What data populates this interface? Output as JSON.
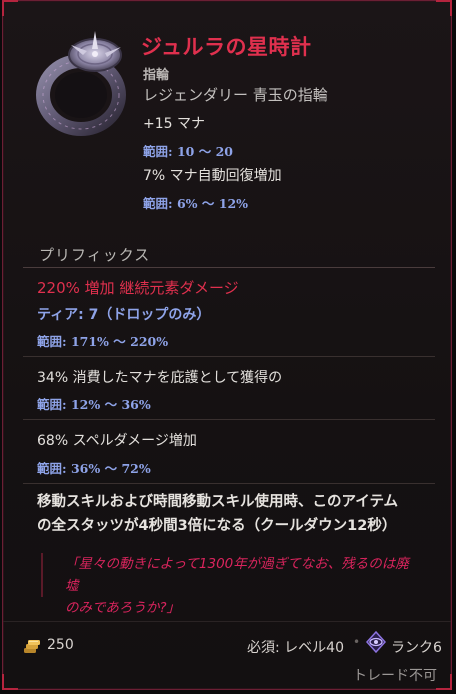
{
  "item": {
    "name": "ジュルラの星時計",
    "type": "指輪",
    "rarity_line": "レジェンダリー 青玉の指輪"
  },
  "implicits": [
    {
      "stat": "+15 マナ",
      "range": "範囲: 10 〜 20"
    },
    {
      "stat": "7% マナ自動回復増加",
      "range": "範囲: 6% 〜 12%"
    }
  ],
  "prefixes": {
    "header": "プリフィックス",
    "mods": [
      {
        "stat": "220% 増加 継続元素ダメージ",
        "tier": "ティア: 7（ドロップのみ）",
        "range": "範囲: 171% 〜 220%"
      },
      {
        "stat": "34% 消費したマナを庇護として獲得の",
        "range": "範囲: 12% 〜 36%"
      },
      {
        "stat": "68% スペルダメージ増加",
        "range": "範囲: 36% 〜 72%"
      }
    ]
  },
  "unique_effect": {
    "line1": "移動スキルおよび時間移動スキル使用時、このアイテム",
    "line2": "の全スタッツが4秒間3倍になる（クールダウン12秒）"
  },
  "lore": {
    "line1": "「星々の動きによって1300年が過ぎてなお、残るのは廃墟",
    "line2": "のみであろうか?」"
  },
  "footer": {
    "gold_value": "250",
    "requirement": "必須: レベル40",
    "separator": "•",
    "rank": "ランク6",
    "trade": "トレード不可",
    "gold_icon": "gold-coins-icon",
    "rank_icon": "rank-emblem-icon"
  },
  "colors": {
    "accent_red": "#e0304e",
    "range_blue": "#8ea3e8",
    "lore_pink": "#d9245d"
  }
}
